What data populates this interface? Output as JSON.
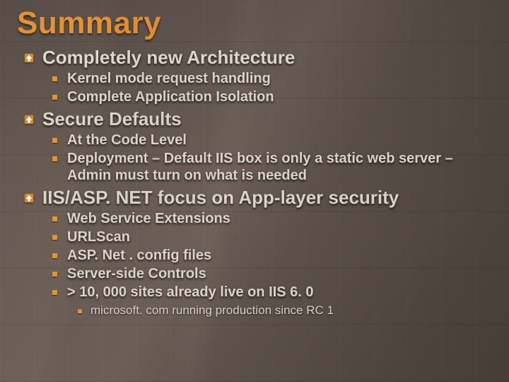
{
  "title": "Summary",
  "sections": [
    {
      "heading": "Completely new Architecture",
      "alt": false,
      "items": [
        {
          "text": "Kernel mode request handling"
        },
        {
          "text": "Complete Application Isolation"
        }
      ]
    },
    {
      "heading": "Secure Defaults",
      "alt": true,
      "items": [
        {
          "text": "At the Code Level"
        },
        {
          "text": "Deployment – Default IIS box is only a static web server – Admin must turn on what is needed"
        }
      ]
    },
    {
      "heading": "IIS/ASP. NET focus on App-layer security",
      "alt": true,
      "items": [
        {
          "text": "Web Service Extensions"
        },
        {
          "text": "URLScan"
        },
        {
          "text": "ASP. Net . config files"
        },
        {
          "text": "Server-side Controls"
        },
        {
          "text": "> 10, 000 sites already live on IIS 6. 0",
          "sub": [
            {
              "text": "microsoft. com running production since RC 1"
            }
          ]
        }
      ]
    }
  ]
}
